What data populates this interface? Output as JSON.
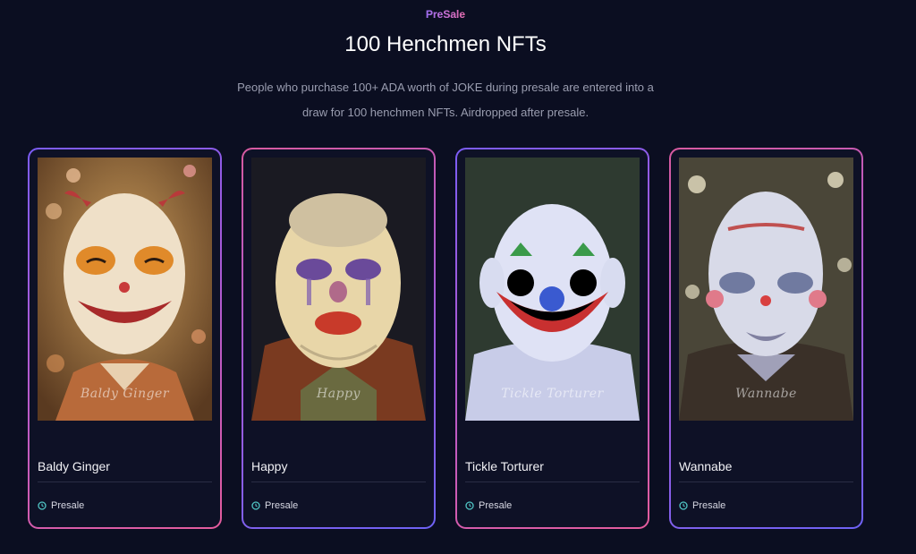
{
  "header": {
    "eyebrow": "PreSale",
    "title": "100 Henchmen NFTs",
    "subtitle": "People who purchase 100+ ADA worth of JOKE during presale are entered into a draw for 100 henchmen NFTs. Airdropped after presale."
  },
  "colors": {
    "background": "#0b0e21",
    "card_background": "#0e1126",
    "accent_purple": "#7b5cf5",
    "accent_pink": "#e45c9c",
    "status_icon": "#4fc3c3"
  },
  "cards": [
    {
      "name": "Baldy Ginger",
      "watermark": "Baldy Ginger",
      "status": "Presale",
      "status_icon": "clock-icon"
    },
    {
      "name": "Happy",
      "watermark": "Happy",
      "status": "Presale",
      "status_icon": "clock-icon"
    },
    {
      "name": "Tickle Torturer",
      "watermark": "Tickle Torturer",
      "status": "Presale",
      "status_icon": "clock-icon"
    },
    {
      "name": "Wannabe",
      "watermark": "Wannabe",
      "status": "Presale",
      "status_icon": "clock-icon"
    }
  ]
}
